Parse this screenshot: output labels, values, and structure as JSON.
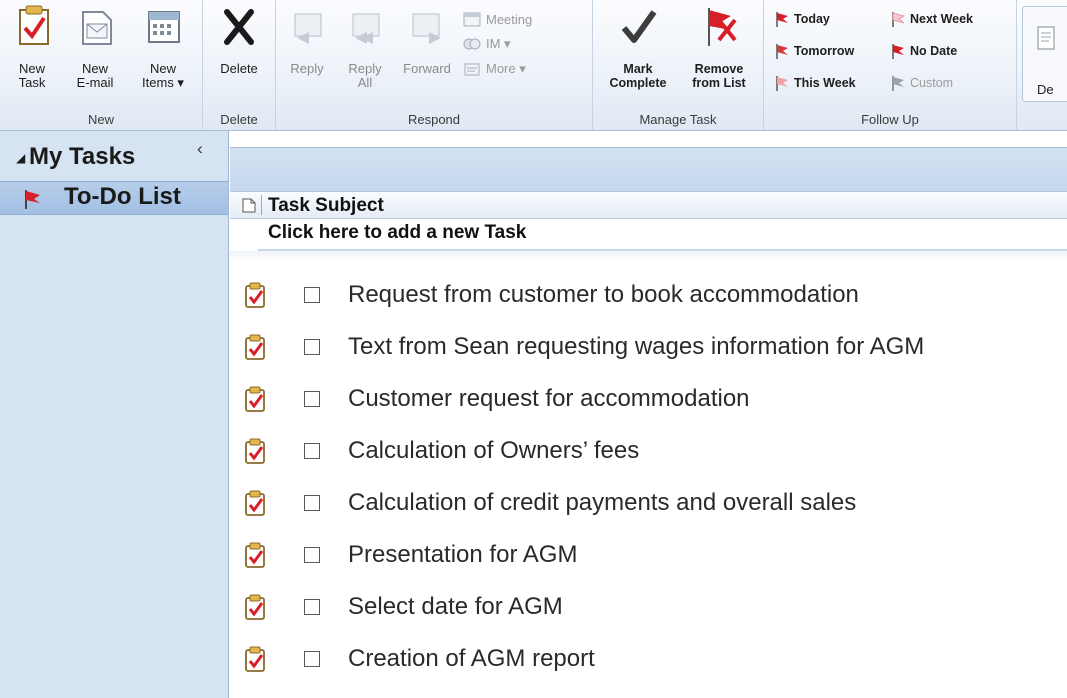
{
  "ribbon": {
    "new_group": {
      "label": "New",
      "new_task": "New\nTask",
      "new_email": "New\nE-mail",
      "new_items": "New\nItems ▾"
    },
    "delete_group": {
      "label": "Delete",
      "delete": "Delete"
    },
    "respond_group": {
      "label": "Respond",
      "reply": "Reply",
      "reply_all": "Reply\nAll",
      "forward": "Forward",
      "meeting": "Meeting",
      "im": "IM ▾",
      "more": "More ▾"
    },
    "manage_group": {
      "label": "Manage Task",
      "mark_complete": "Mark\nComplete",
      "remove_from_list": "Remove\nfrom List"
    },
    "followup_group": {
      "label": "Follow Up",
      "today": "Today",
      "tomorrow": "Tomorrow",
      "this_week": "This Week",
      "next_week": "Next Week",
      "no_date": "No Date",
      "custom": "Custom"
    },
    "edge_button": "De"
  },
  "nav": {
    "header": "My Tasks",
    "collapse_glyph": "‹",
    "selected_item": "To-Do List"
  },
  "list": {
    "column_header": "Task Subject",
    "new_task_prompt": "Click here to add a new Task",
    "tasks": [
      "Request from customer to book accommodation",
      "Text from Sean requesting wages information for AGM",
      "Customer request for accommodation",
      "Calculation of Owners’ fees",
      "Calculation of credit payments and overall sales",
      "Presentation for AGM",
      "Select date for AGM",
      "Creation of AGM report"
    ]
  },
  "colors": {
    "flag_red": "#d61f26",
    "flag_pink": "#f0a0a8",
    "nav_bg": "#d6e3f2",
    "ribbon_bg": "#eef3f9"
  }
}
